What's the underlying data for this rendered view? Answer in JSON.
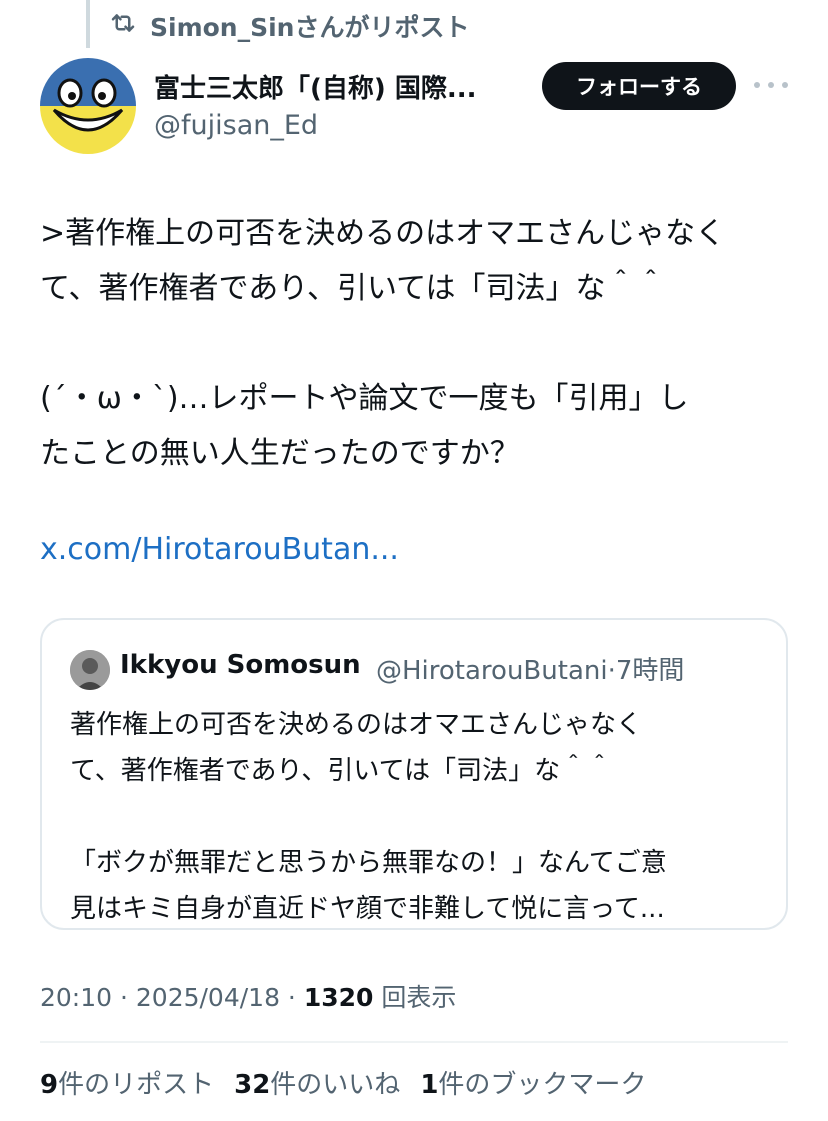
{
  "repost": {
    "icon": "repost-icon",
    "text": "Simon_Sinさんがリポスト"
  },
  "author": {
    "name": "富士三太郎「(自称) 国際...",
    "handle": "@fujisan_Ed",
    "avatar": "smiley-face-avatar",
    "avatar_colors": {
      "top": "#3a6fb0",
      "bottom": "#f3e14a"
    }
  },
  "actions": {
    "follow_label": "フォローする",
    "more_icon": "more-icon"
  },
  "tweet": {
    "paragraph_1": ">著作権上の可否を決めるのはオマエさんじゃなく\nて、著作権者であり、引いては「司法」な＾＾",
    "paragraph_2": "(´・ω・`)…レポートや論文で一度も「引用」し\nたことの無い人生だったのですか？",
    "link": "x.com/HirotarouButan..."
  },
  "quote": {
    "name": "Ikkyou Somosun",
    "handle": "@HirotarouButani",
    "time": "7時間",
    "paragraph_1": "著作権上の可否を決めるのはオマエさんじゃなく\nて、著作権者であり、引いては「司法」な＾＾",
    "paragraph_2": "「ボクが無罪だと思うから無罪なの！」なんてご意\n見はキミ自身が直近ドヤ顔で非難して悦に言って..."
  },
  "meta": {
    "time": "20:10",
    "date": "2025/04/18",
    "views_count": "1320",
    "views_label": "回表示"
  },
  "stats": {
    "reposts_count": "9",
    "reposts_label": "件のリポスト",
    "likes_count": "32",
    "likes_label": "件のいいね",
    "bookmarks_count": "1",
    "bookmarks_label": "件のブックマーク"
  },
  "colors": {
    "link": "#1d6fc4",
    "secondary_text": "#536471",
    "primary_text": "#0f1419"
  }
}
